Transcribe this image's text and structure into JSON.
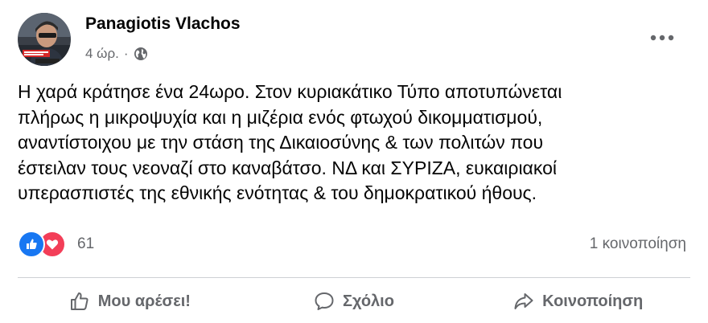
{
  "post": {
    "author": "Panagiotis Vlachos",
    "time": "4 ώρ.",
    "separator": "·",
    "privacy_icon": "globe-icon",
    "text_lines": [
      "Η χαρά κράτησε ένα 24ωρο. Στον κυριακάτικο Τύπο αποτυπώνεται",
      "πλήρως η μικροψυχία και η μιζέρια ενός φτωχού δικομματισμού,",
      "αναντίστοιχου με την στάση της Δικαιοσύνης & των πολιτών που",
      "έστειλαν τους νεοναζί στο καναβάτσο. ΝΔ και ΣΥΡΙΖΑ, ευκαιριακοί",
      "υπερασπιστές της εθνικής ενότητας & του δημοκρατικού ήθους."
    ]
  },
  "reactions": {
    "icons": [
      "like-icon",
      "love-icon"
    ],
    "count": "61",
    "shares": "1 κοινοποίηση"
  },
  "actions": {
    "like": "Μου αρέσει!",
    "comment": "Σχόλιο",
    "share": "Κοινοποίηση"
  },
  "colors": {
    "text": "#050505",
    "secondary": "#65676b",
    "like_blue": "#1877f2",
    "love_red": "#f33e58",
    "divider": "#ced0d4"
  }
}
